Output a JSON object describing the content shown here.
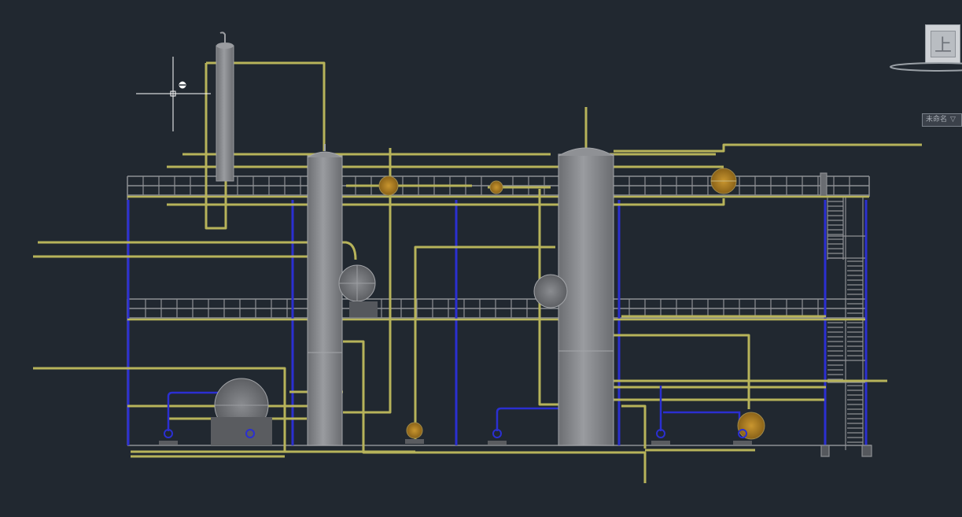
{
  "viewcube": {
    "face_label": "上"
  },
  "ucs_menu": {
    "label": "未命名",
    "arrow": "▽"
  },
  "colors": {
    "background": "#212830",
    "pipe_yellow": "#b7b35a",
    "pipe_blue": "#2b2fd1",
    "structure_gray": "#8e9094",
    "vessel_gray": "#7d7f83",
    "valve_orange": "#b9872c",
    "crosshair": "#ffffff"
  },
  "icons": {
    "cursor": "crosshair-cursor-icon",
    "viewcube": "viewcube-icon",
    "compass": "compass-ring-icon"
  }
}
